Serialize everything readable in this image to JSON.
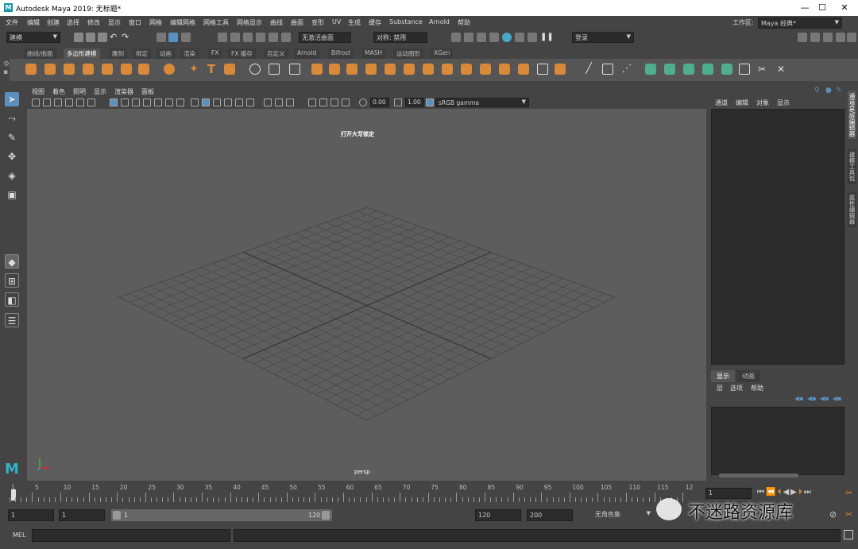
{
  "window": {
    "title": "Autodesk Maya 2019: 无标题*",
    "logo": "M",
    "controls": [
      "—",
      "☐",
      "✕"
    ]
  },
  "menubar": {
    "items": [
      "文件",
      "编辑",
      "创建",
      "选择",
      "修改",
      "显示",
      "窗口",
      "网格",
      "编辑网格",
      "网格工具",
      "网格显示",
      "曲线",
      "曲面",
      "变形",
      "UV",
      "生成",
      "缓存",
      "Substance",
      "Arnold",
      "帮助"
    ],
    "workspace_label": "工作区:",
    "workspace_value": "Maya 经典*"
  },
  "statusline": {
    "mode_value": "建模",
    "live_surface": "无激活曲面",
    "symmetry": "对称: 禁用",
    "login": "登录"
  },
  "shelf": {
    "tabs": [
      "曲线/曲面",
      "多边形建模",
      "雕刻",
      "绑定",
      "动画",
      "渲染",
      "FX",
      "FX 缓存",
      "自定义",
      "Arnold",
      "Bifrost",
      "MASH",
      "运动图形",
      "XGen"
    ],
    "active_tab": 1
  },
  "panel": {
    "menus": [
      "视图",
      "着色",
      "照明",
      "显示",
      "渲染器",
      "面板"
    ],
    "exposure": "0.00",
    "gamma": "1.00",
    "color_space": "sRGB gamma",
    "hud_message": "打开大写锁定",
    "camera_label": "persp"
  },
  "channelbox": {
    "menus": [
      "通道",
      "编辑",
      "对象",
      "显示"
    ]
  },
  "right_vertical_tabs": [
    "通道盒/层编辑器",
    "建模工具包",
    "属性编辑器"
  ],
  "layer_editor": {
    "tabs": [
      "显示",
      "动画"
    ],
    "menus": [
      "层",
      "选项",
      "帮助"
    ]
  },
  "timeslider": {
    "ticks": [
      "5",
      "10",
      "15",
      "20",
      "25",
      "30",
      "35",
      "40",
      "45",
      "50",
      "55",
      "60",
      "65",
      "70",
      "75",
      "80",
      "85",
      "90",
      "95",
      "100",
      "105",
      "110",
      "115",
      "12"
    ],
    "start_marker": "1",
    "current_frame": "1"
  },
  "rangebar": {
    "start": "1",
    "playback_start": "1",
    "range_left": "1",
    "range_right": "120",
    "playback_end": "120",
    "end": "200",
    "character_set": "无角色集"
  },
  "cmdline": {
    "label": "MEL"
  },
  "watermark": {
    "text": "不迷路资源库"
  },
  "colors": {
    "shelf_orange": "#d9893a",
    "shelf_green": "#4fae8e",
    "viewport_bg": "#5d5d5d",
    "grid_line": "#4a4a4a",
    "grid_axis": "#3a3a3a"
  }
}
